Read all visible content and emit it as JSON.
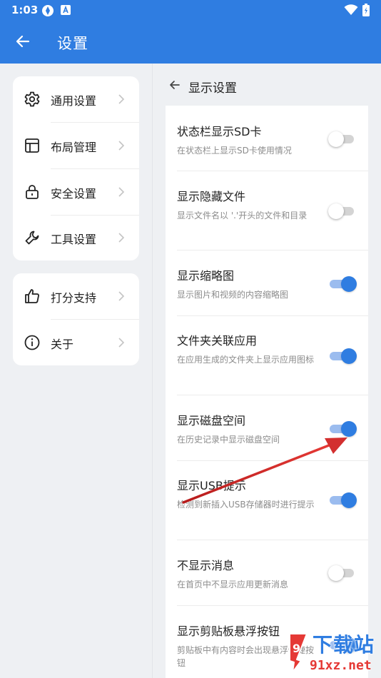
{
  "status_bar": {
    "time": "1:03"
  },
  "app_bar": {
    "title": "设置"
  },
  "nav_groups": [
    [
      {
        "label": "通用设置",
        "icon": "gear-icon"
      },
      {
        "label": "布局管理",
        "icon": "layout-icon"
      },
      {
        "label": "安全设置",
        "icon": "lock-icon"
      },
      {
        "label": "工具设置",
        "icon": "wrench-icon"
      }
    ],
    [
      {
        "label": "打分支持",
        "icon": "thumbs-up-icon"
      },
      {
        "label": "关于",
        "icon": "info-icon"
      }
    ]
  ],
  "display_settings": {
    "title": "显示设置",
    "items": [
      {
        "title": "状态栏显示SD卡",
        "desc": "在状态栏上显示SD卡使用情况",
        "enabled": false
      },
      {
        "title": "显示隐藏文件",
        "desc": "显示文件名以 '.'开头的文件和目录",
        "enabled": false
      },
      {
        "title": "显示缩略图",
        "desc": "显示图片和视频的内容缩略图",
        "enabled": true
      },
      {
        "title": "文件夹关联应用",
        "desc": "在应用生成的文件夹上显示应用图标",
        "enabled": true
      },
      {
        "title": "显示磁盘空间",
        "desc": "在历史记录中显示磁盘空间",
        "enabled": true
      },
      {
        "title": "显示USB提示",
        "desc": "检测到新插入USB存储器时进行提示",
        "enabled": true
      },
      {
        "title": "不显示消息",
        "desc": "在首页中不显示应用更新消息",
        "enabled": false
      },
      {
        "title": "显示剪贴板悬浮按钮",
        "desc": "剪贴板中有内容时会出现悬浮快捷按钮",
        "enabled": true
      }
    ]
  },
  "watermark": {
    "title": "下载站",
    "url": "91xz.net"
  },
  "colors": {
    "primary": "#2f7de1",
    "annotation_arrow": "#d32f2f"
  }
}
